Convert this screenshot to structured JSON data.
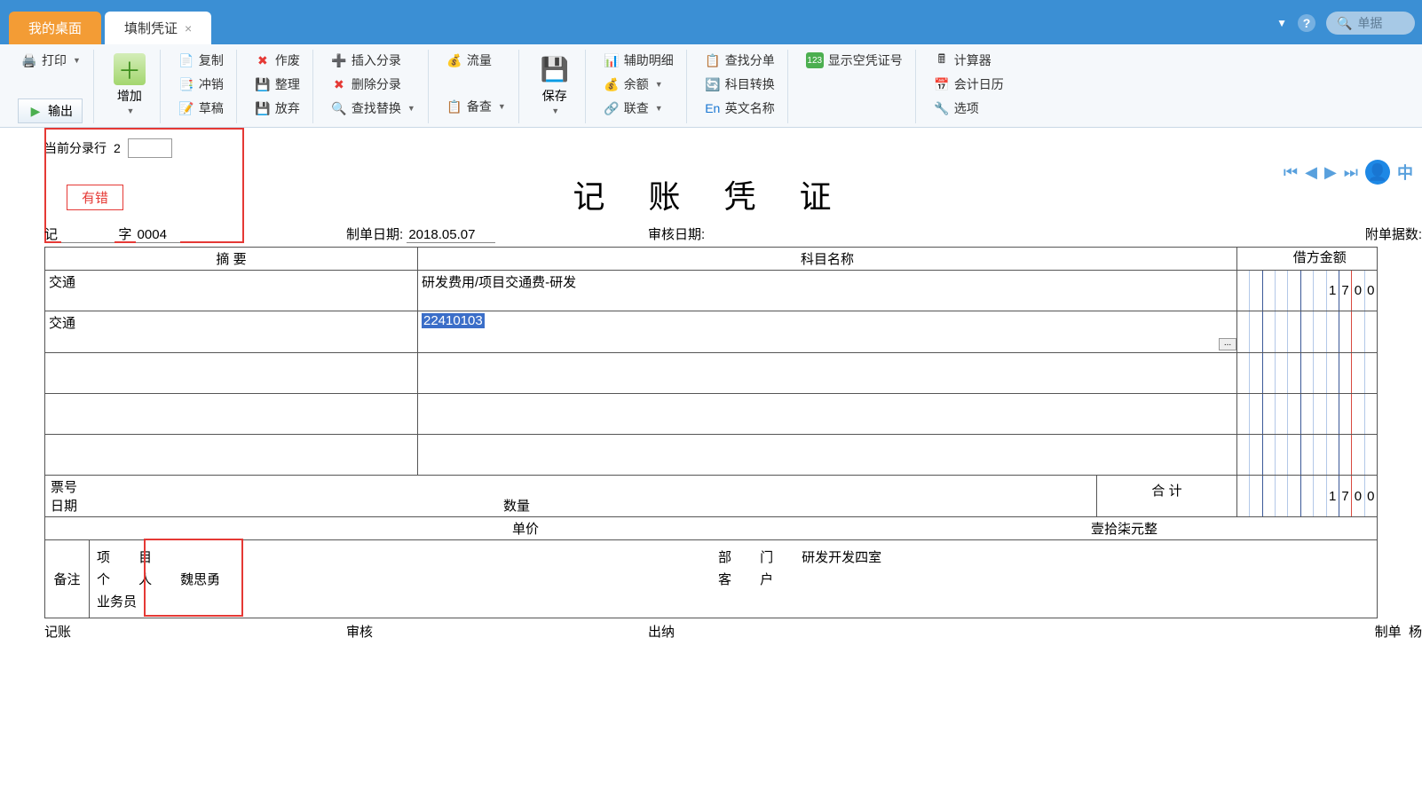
{
  "tabs": {
    "desktop": "我的桌面",
    "voucher": "填制凭证"
  },
  "search": {
    "placeholder": "单据"
  },
  "ribbon": {
    "print": "打印",
    "export": "输出",
    "add": "增加",
    "copy": "复制",
    "reverse": "冲销",
    "draft": "草稿",
    "void": "作废",
    "tidy": "整理",
    "abandon": "放弃",
    "insertEntry": "插入分录",
    "deleteEntry": "删除分录",
    "findReplace": "查找替换",
    "flow": "流量",
    "save": "保存",
    "backup": "备查",
    "aux": "辅助明细",
    "balance": "余额",
    "related": "联查",
    "findEntry": "查找分单",
    "acctConv": "科目转换",
    "engName": "英文名称",
    "showEmpty": "显示空凭证号",
    "calc": "计算器",
    "calendar": "会计日历",
    "options": "选项"
  },
  "header": {
    "curEntryLabel": "当前分录行",
    "curEntryNo": "2",
    "errorFlag": "有错",
    "typePrefix": "记",
    "typeSuffix": "字",
    "voucherNo": "0004",
    "title": "记 账 凭 证",
    "makeDateLabel": "制单日期:",
    "makeDate": "2018.05.07",
    "auditDateLabel": "审核日期:",
    "attachLabel": "附单据数:"
  },
  "cols": {
    "summary": "摘 要",
    "account": "科目名称",
    "debit": "借方金额"
  },
  "entries": [
    {
      "summary": "交通",
      "account": "研发费用/项目交通费-研发",
      "debit": "1700"
    },
    {
      "summary": "交通",
      "account": "22410103",
      "debit": "",
      "selected": true,
      "hasBtn": true
    },
    {
      "summary": "",
      "account": "",
      "debit": ""
    },
    {
      "summary": "",
      "account": "",
      "debit": ""
    },
    {
      "summary": "",
      "account": "",
      "debit": ""
    }
  ],
  "extra": {
    "ticketLabel": "票号",
    "dateLabel": "日期",
    "qtyLabel": "数量",
    "priceLabel": "单价",
    "totalLabel": "合 计",
    "totalDebit": "1700",
    "chineseAmount": "壹拾柒元整"
  },
  "remark": {
    "label": "备注",
    "project": "项 目",
    "projectVal": "",
    "person": "个 人",
    "personVal": "魏思勇",
    "biz": "业务员",
    "bizVal": "",
    "dept": "部 门",
    "deptVal": "研发开发四室",
    "cust": "客 户",
    "custVal": ""
  },
  "sign": {
    "book": "记账",
    "audit": "审核",
    "cashier": "出纳",
    "maker": "制单",
    "makerVal": "杨"
  },
  "nav": {
    "cn": "中"
  }
}
